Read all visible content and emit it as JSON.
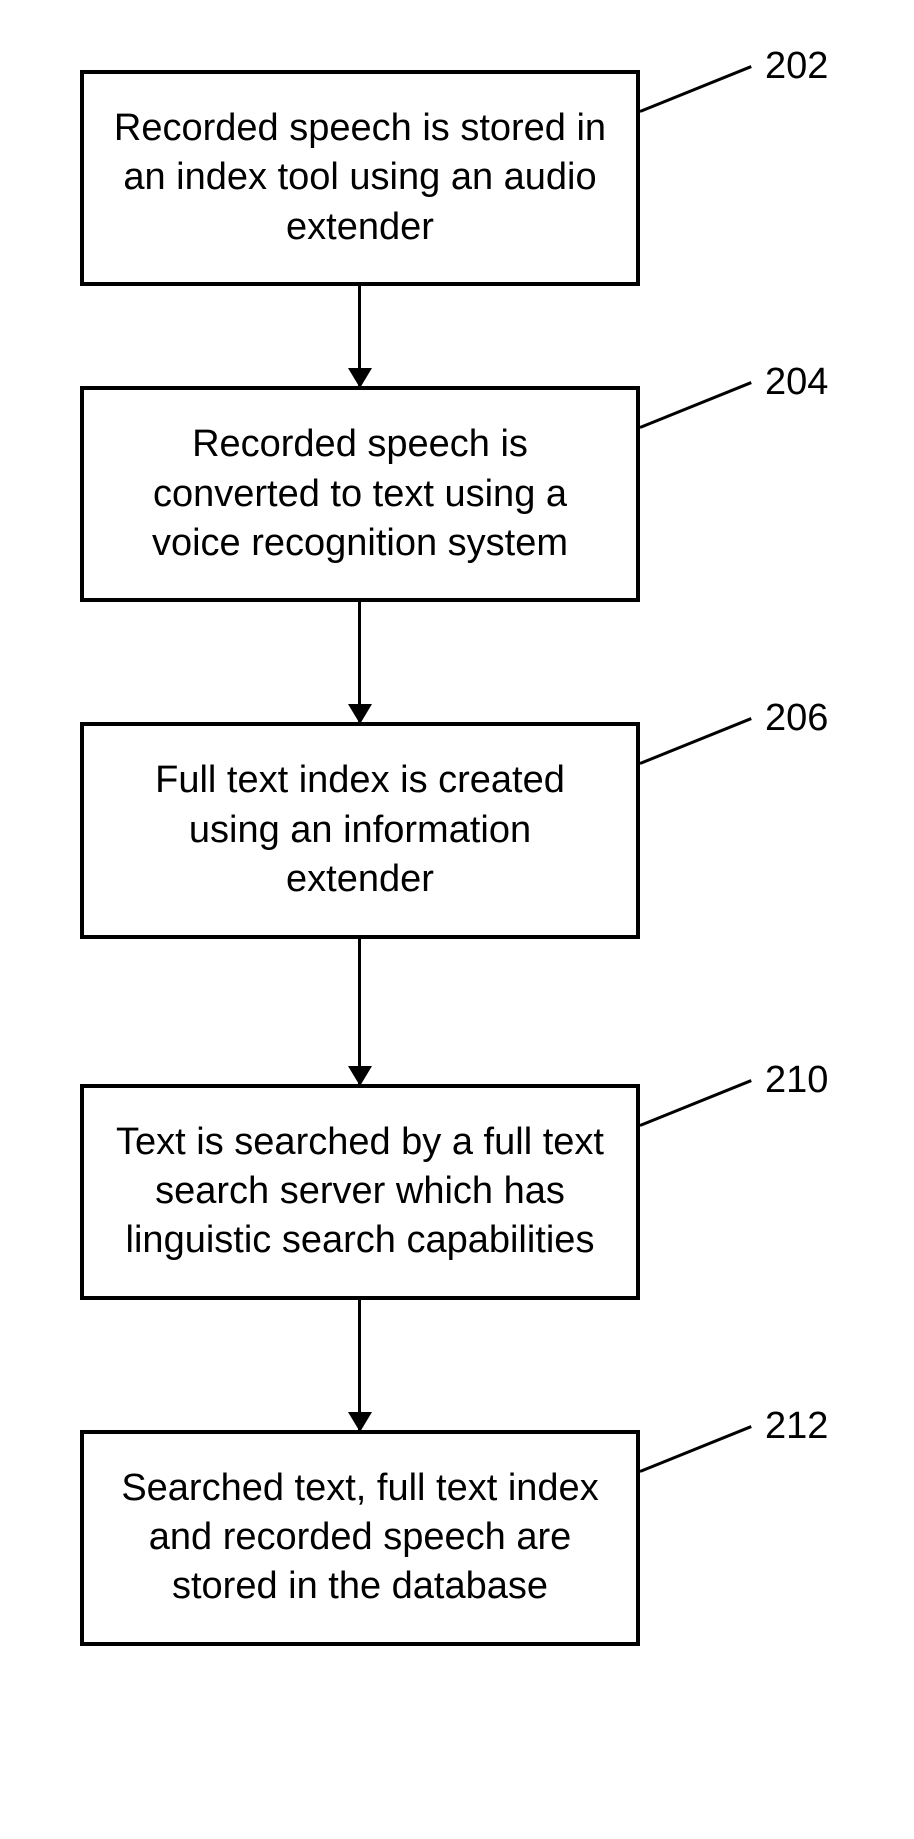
{
  "flowchart": {
    "steps": [
      {
        "text": "Recorded speech is stored in an index tool using an audio extender",
        "ref": "202"
      },
      {
        "text": "Recorded speech is converted to text using a voice recognition system",
        "ref": "204"
      },
      {
        "text": "Full text index is created using an information extender",
        "ref": "206"
      },
      {
        "text": "Text is searched by a full text search server which has linguistic search capabilities",
        "ref": "210"
      },
      {
        "text": "Searched text, full text index and recorded speech are stored in the database",
        "ref": "212"
      }
    ]
  }
}
